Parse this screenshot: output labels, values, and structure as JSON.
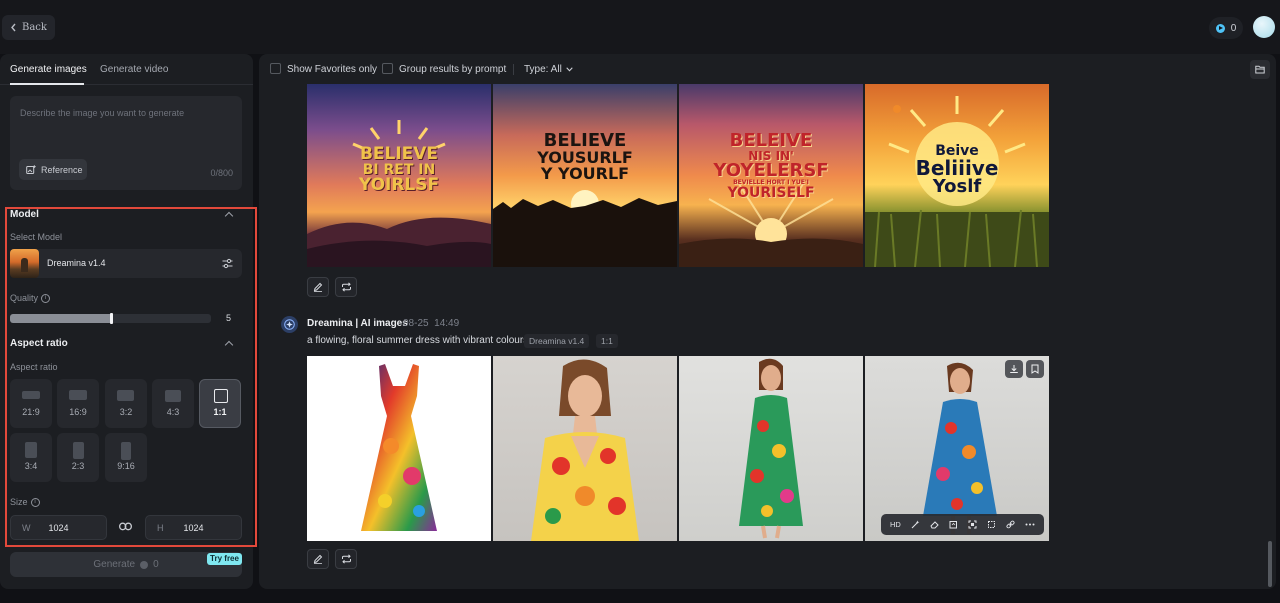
{
  "topbar": {
    "back_label": "Back",
    "credits": "0"
  },
  "left_panel": {
    "tabs": [
      {
        "label": "Generate images"
      },
      {
        "label": "Generate video"
      }
    ],
    "prompt": {
      "placeholder": "Describe the image you want to generate",
      "reference_label": "Reference",
      "counter": "0/800"
    },
    "model": {
      "section_title": "Model",
      "select_label": "Select Model",
      "selected": "Dreamina v1.4"
    },
    "quality": {
      "label": "Quality",
      "value": "5",
      "fraction": 0.5
    },
    "aspect": {
      "section_title": "Aspect ratio",
      "label": "Aspect ratio",
      "options": [
        {
          "label": "21:9"
        },
        {
          "label": "16:9"
        },
        {
          "label": "3:2"
        },
        {
          "label": "4:3"
        },
        {
          "label": "1:1"
        },
        {
          "label": "3:4"
        },
        {
          "label": "2:3"
        },
        {
          "label": "9:16"
        }
      ],
      "selected": "1:1"
    },
    "size": {
      "label": "Size",
      "w_prefix": "W",
      "w_value": "1024",
      "h_prefix": "H",
      "h_value": "1024"
    },
    "generate": {
      "label": "Generate",
      "cost": "0",
      "badge": "Try free"
    }
  },
  "results": {
    "filters": {
      "favorites_label": "Show Favorites only",
      "group_label": "Group results by prompt",
      "type_label": "Type: All"
    },
    "batch1": {
      "images": [
        {
          "lines": [
            "BELIEVE",
            "BI RET IN",
            "YOIRLSF"
          ]
        },
        {
          "lines": [
            "BELIEVE",
            "YOUSURLF",
            "Y YOURLF"
          ]
        },
        {
          "lines": [
            "BELEIVE",
            "NIS IN'",
            "YOYELERSF",
            "BEVIELLE HORT I YUE'I",
            "YOURISELF"
          ]
        },
        {
          "lines": [
            "Beive",
            "Beliiive",
            "Yoslf"
          ]
        }
      ]
    },
    "batch2": {
      "author": "Dreamina | AI images",
      "date": "08-25",
      "time": "14:49",
      "prompt": "a flowing, floral summer dress with vibrant colours",
      "tags": [
        "Dreamina v1.4",
        "1:1"
      ],
      "hover_tools": [
        "HD"
      ]
    }
  }
}
